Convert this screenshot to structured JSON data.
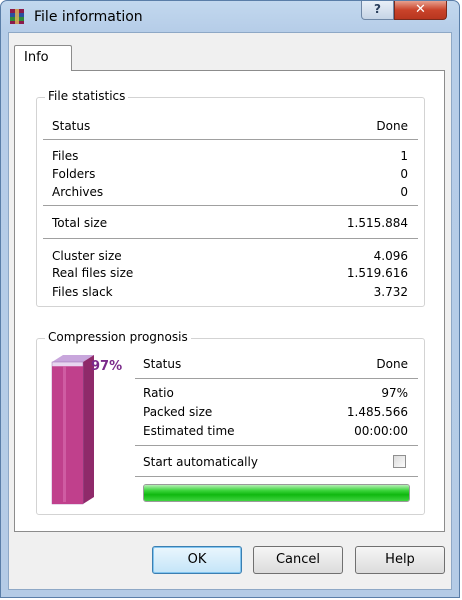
{
  "window": {
    "title": "File information"
  },
  "titlebar": {
    "help_glyph": "?",
    "close_glyph": "✕"
  },
  "tabs": [
    {
      "label": "Info"
    }
  ],
  "file_statistics": {
    "title": "File statistics",
    "status": {
      "label": "Status",
      "value": "Done"
    },
    "counts": [
      {
        "label": "Files",
        "value": "1"
      },
      {
        "label": "Folders",
        "value": "0"
      },
      {
        "label": "Archives",
        "value": "0"
      }
    ],
    "total": {
      "label": "Total size",
      "value": "1.515.884"
    },
    "sizes": [
      {
        "label": "Cluster size",
        "value": "4.096"
      },
      {
        "label": "Real files size",
        "value": "1.519.616"
      },
      {
        "label": "Files slack",
        "value": "3.732"
      }
    ]
  },
  "compression": {
    "title": "Compression prognosis",
    "percent_label": "97%",
    "ratio_fraction": 0.97,
    "status": {
      "label": "Status",
      "value": "Done"
    },
    "details": [
      {
        "label": "Ratio",
        "value": "97%"
      },
      {
        "label": "Packed size",
        "value": "1.485.566"
      },
      {
        "label": "Estimated time",
        "value": "00:00:00"
      }
    ],
    "start_auto_label": "Start automatically",
    "start_auto_checked": false,
    "progress_fraction": 1.0
  },
  "buttons": {
    "ok": "OK",
    "cancel": "Cancel",
    "help": "Help"
  },
  "colors": {
    "bar_fill": "#c0408c",
    "progress_green": "#22c322",
    "percent_text": "#7a2a8a"
  }
}
